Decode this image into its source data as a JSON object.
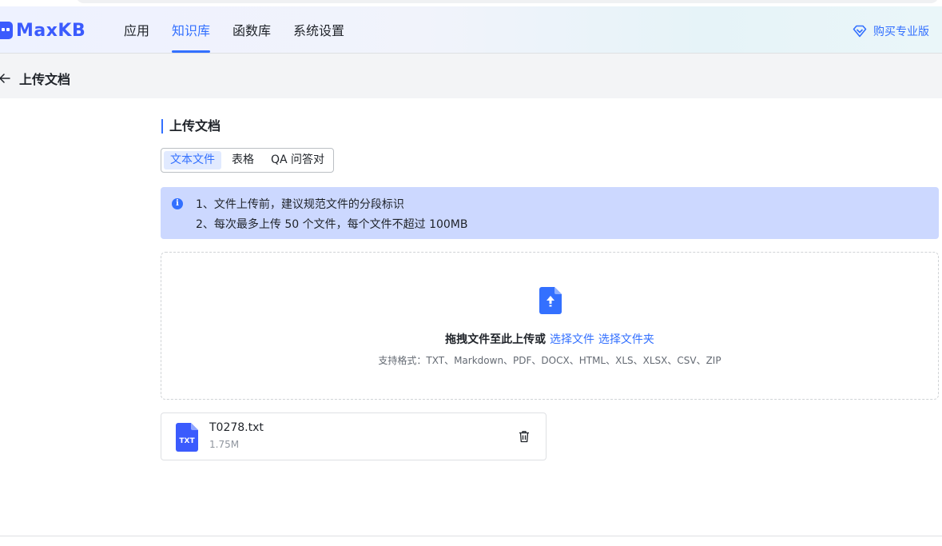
{
  "app": {
    "logo_text": "MaxKB"
  },
  "nav": [
    {
      "label": "应用",
      "active": false
    },
    {
      "label": "知识库",
      "active": true
    },
    {
      "label": "函数库",
      "active": false
    },
    {
      "label": "系统设置",
      "active": false
    }
  ],
  "header": {
    "buy_label": "购买专业版",
    "buy_icon": "diamond-icon"
  },
  "subheader": {
    "back_icon": "arrow-left-icon",
    "title": "上传文档"
  },
  "section": {
    "title": "上传文档"
  },
  "tabs": [
    {
      "label": "文本文件",
      "active": true
    },
    {
      "label": "表格",
      "active": false
    },
    {
      "label": "QA 问答对",
      "active": false
    }
  ],
  "alert": {
    "icon": "info-icon",
    "lines": [
      "1、文件上传前，建议规范文件的分段标识",
      "2、每次最多上传 50 个文件，每个文件不超过 100MB"
    ]
  },
  "upload": {
    "icon": "file-upload-icon",
    "prompt": "拖拽文件至此上传或",
    "select_file": "选择文件",
    "select_folder": "选择文件夹",
    "formats": "支持格式：TXT、Markdown、PDF、DOCX、HTML、XLS、XLSX、CSV、ZIP"
  },
  "files": [
    {
      "name": "T0278.txt",
      "size": "1.75M",
      "type_label": "TXT",
      "icon": "txt-file-icon",
      "delete_icon": "trash-icon"
    }
  ],
  "colors": {
    "accent": "#3370ff",
    "alert_bg": "#ccd8ff",
    "file_icon": "#3b5bfd"
  }
}
